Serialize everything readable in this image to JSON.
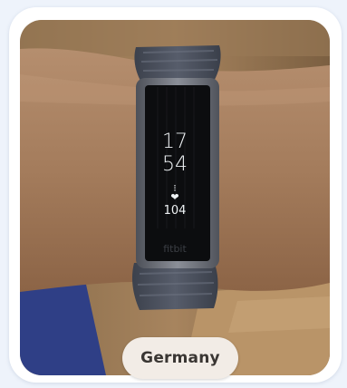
{
  "badge": {
    "label": "Germany"
  },
  "tracker_screen": {
    "hour": "17",
    "minute": "54",
    "hr_icon": "heart-icon",
    "steps_icon": "dots-icon",
    "heart_rate": "104"
  },
  "device_brand": "fitbit",
  "colors": {
    "background": "#eef3fb",
    "card": "#ffffff",
    "badge_bg": "#f2ece6",
    "badge_text": "#3a3633",
    "band": "#4a4f5c",
    "screen": "#0c0d0f"
  }
}
